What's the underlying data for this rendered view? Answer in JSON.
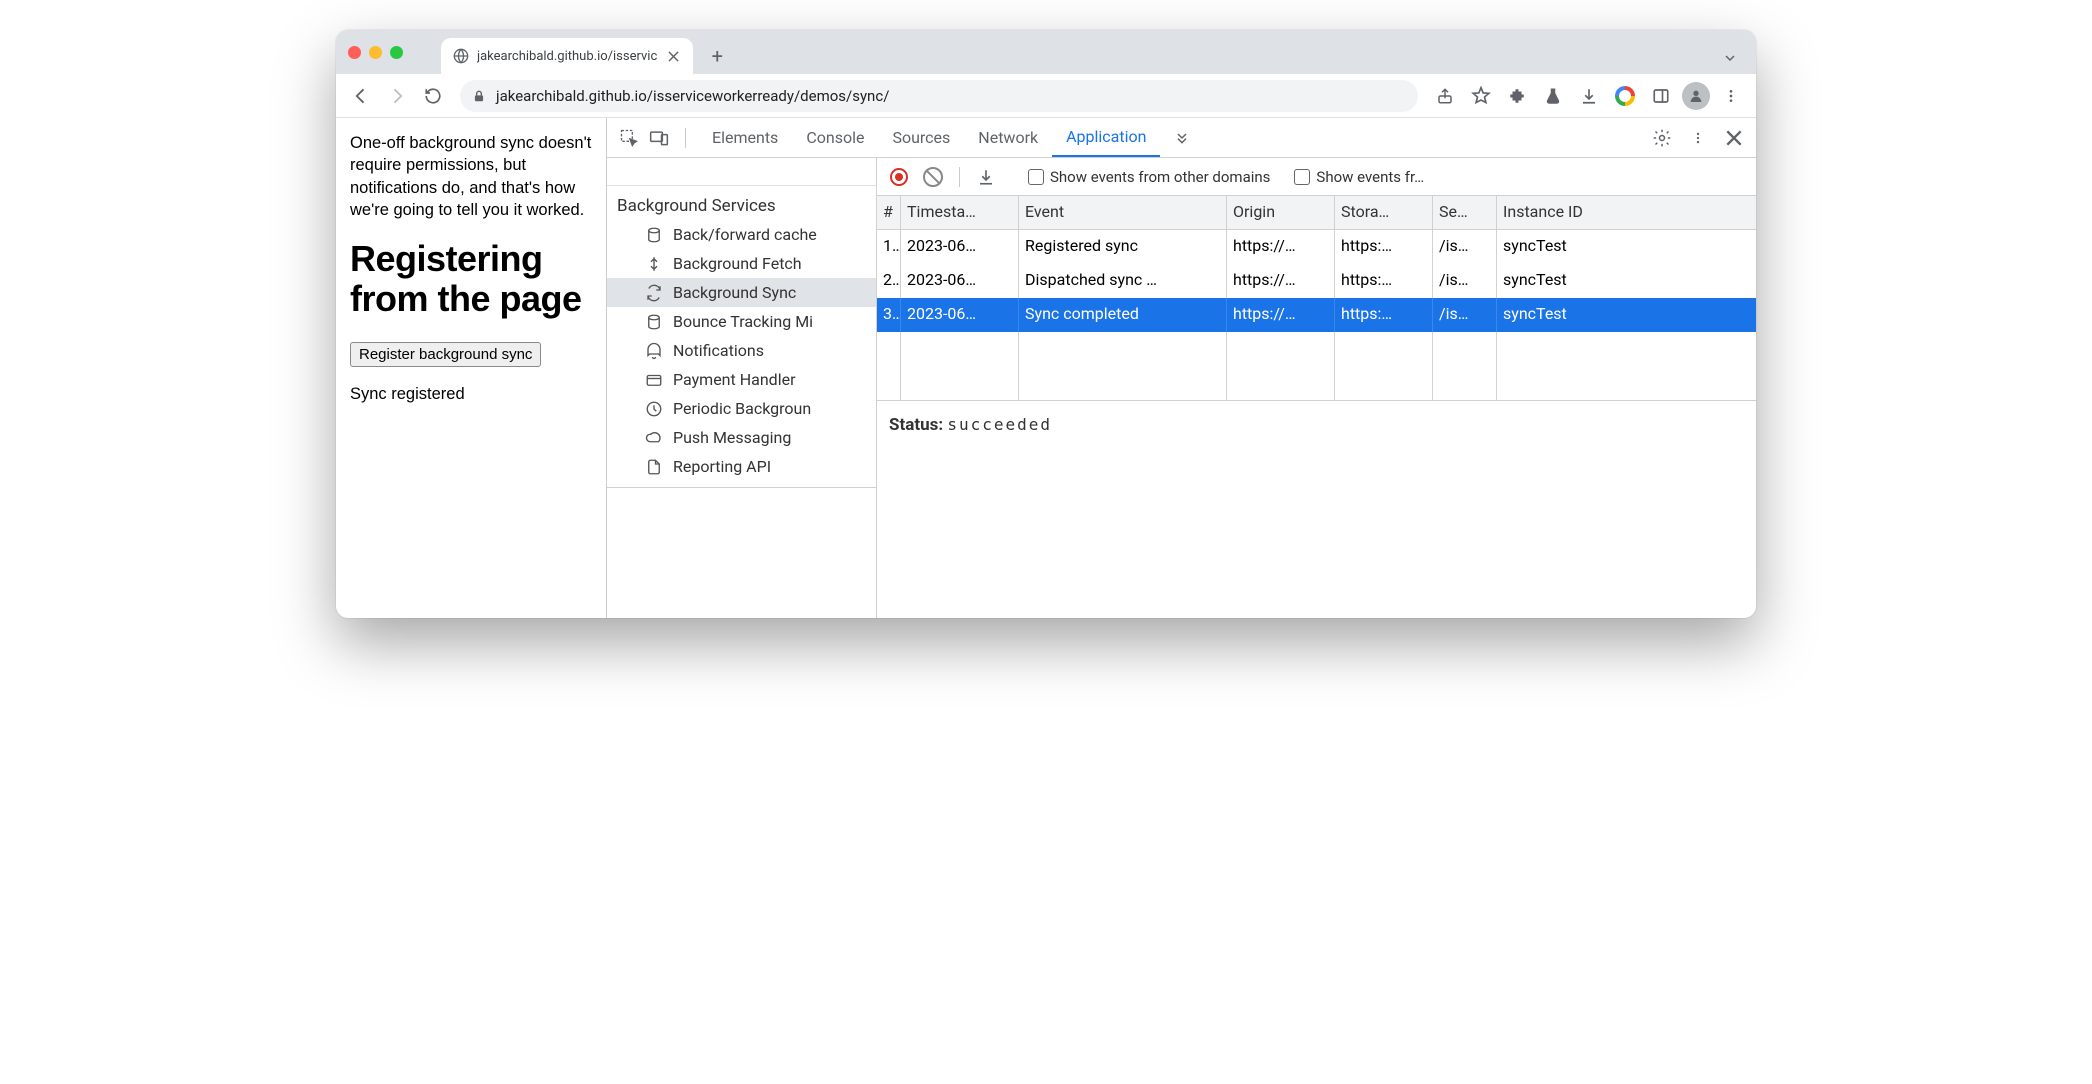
{
  "browser": {
    "tab_title": "jakearchibald.github.io/isservic",
    "url": "jakearchibald.github.io/isserviceworkerready/demos/sync/"
  },
  "page": {
    "intro": "One-off background sync doesn't require permissions, but notifications do, and that's how we're going to tell you it worked.",
    "heading": "Registering from the page",
    "button": "Register background sync",
    "status": "Sync registered"
  },
  "devtools": {
    "tabs": [
      "Elements",
      "Console",
      "Sources",
      "Network",
      "Application"
    ],
    "active_tab": "Application",
    "sidebar_group": "Background Services",
    "sidebar_items": [
      "Back/forward cache",
      "Background Fetch",
      "Background Sync",
      "Bounce Tracking Mi",
      "Notifications",
      "Payment Handler",
      "Periodic Backgroun",
      "Push Messaging",
      "Reporting API"
    ],
    "sidebar_selected": "Background Sync",
    "toolbar": {
      "show_other": "Show events from other domains",
      "show_fr": "Show events fr…"
    },
    "table": {
      "headers": {
        "idx": "#",
        "ts": "Timesta…",
        "event": "Event",
        "origin": "Origin",
        "storage": "Stora…",
        "sw": "Se…",
        "instance": "Instance ID"
      },
      "rows": [
        {
          "idx": "1.",
          "ts": "2023-06…",
          "event": "Registered sync",
          "origin": "https://…",
          "storage": "https:…",
          "sw": "/is…",
          "instance": "syncTest"
        },
        {
          "idx": "2.",
          "ts": "2023-06…",
          "event": "Dispatched sync …",
          "origin": "https://…",
          "storage": "https:…",
          "sw": "/is…",
          "instance": "syncTest"
        },
        {
          "idx": "3.",
          "ts": "2023-06…",
          "event": "Sync completed",
          "origin": "https://…",
          "storage": "https:…",
          "sw": "/is…",
          "instance": "syncTest"
        }
      ],
      "selected_index": 2
    },
    "status_label": "Status:",
    "status_value": "succeeded"
  }
}
